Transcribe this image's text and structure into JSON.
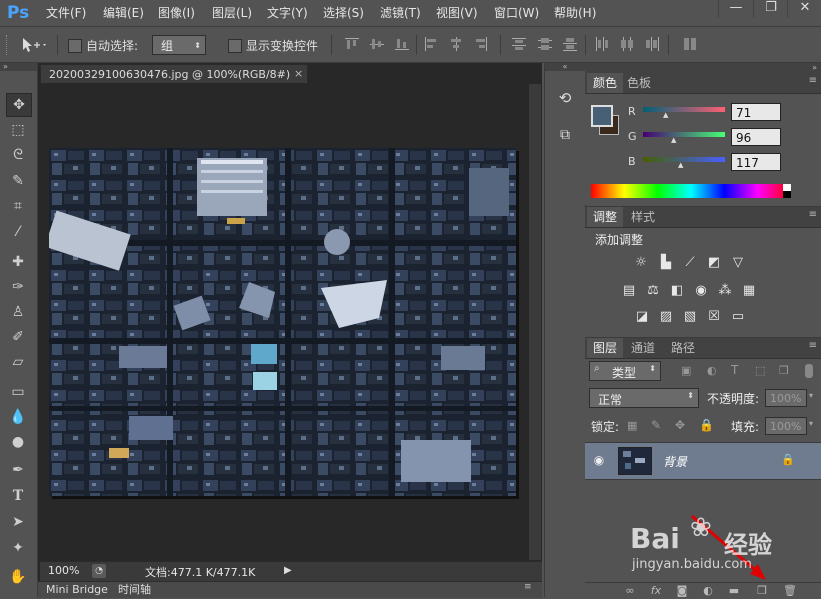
{
  "app": {
    "logo": "Ps"
  },
  "menu": [
    "文件(F)",
    "编辑(E)",
    "图像(I)",
    "图层(L)",
    "文字(Y)",
    "选择(S)",
    "滤镜(T)",
    "视图(V)",
    "窗口(W)",
    "帮助(H)"
  ],
  "window_controls": {
    "minimize": "—",
    "restore": "❐",
    "close": "✕"
  },
  "options_bar": {
    "auto_select_label": "自动选择:",
    "auto_select_value": "组",
    "show_transform_label": "显示变换控件"
  },
  "document": {
    "tab_title": "20200329100630476.jpg @ 100%(RGB/8#)",
    "tab_close": "×",
    "zoom": "100%",
    "doc_size": "文档:477.1 K/477.1K"
  },
  "bottom_dock": {
    "tabs": [
      "Mini Bridge",
      "时间轴"
    ]
  },
  "color_panel": {
    "tabs": [
      "颜色",
      "色板"
    ],
    "r_label": "R",
    "r_value": "71",
    "g_label": "G",
    "g_value": "96",
    "b_label": "B",
    "b_value": "117",
    "fg_color": "#476075",
    "bg_color": "#3a2a1e"
  },
  "adjust_panel": {
    "tabs": [
      "调整",
      "样式"
    ],
    "add_label": "添加调整"
  },
  "layers_panel": {
    "tabs": [
      "图层",
      "通道",
      "路径"
    ],
    "filter_label": "类型",
    "blend_mode": "正常",
    "opacity_label": "不透明度:",
    "opacity_value": "100%",
    "lock_label": "锁定:",
    "fill_label": "填充:",
    "fill_value": "100%",
    "layer_name": "背景"
  },
  "watermark": {
    "brand": "Bai",
    "brand2": "经验",
    "url": "jingyan.baidu.com"
  }
}
